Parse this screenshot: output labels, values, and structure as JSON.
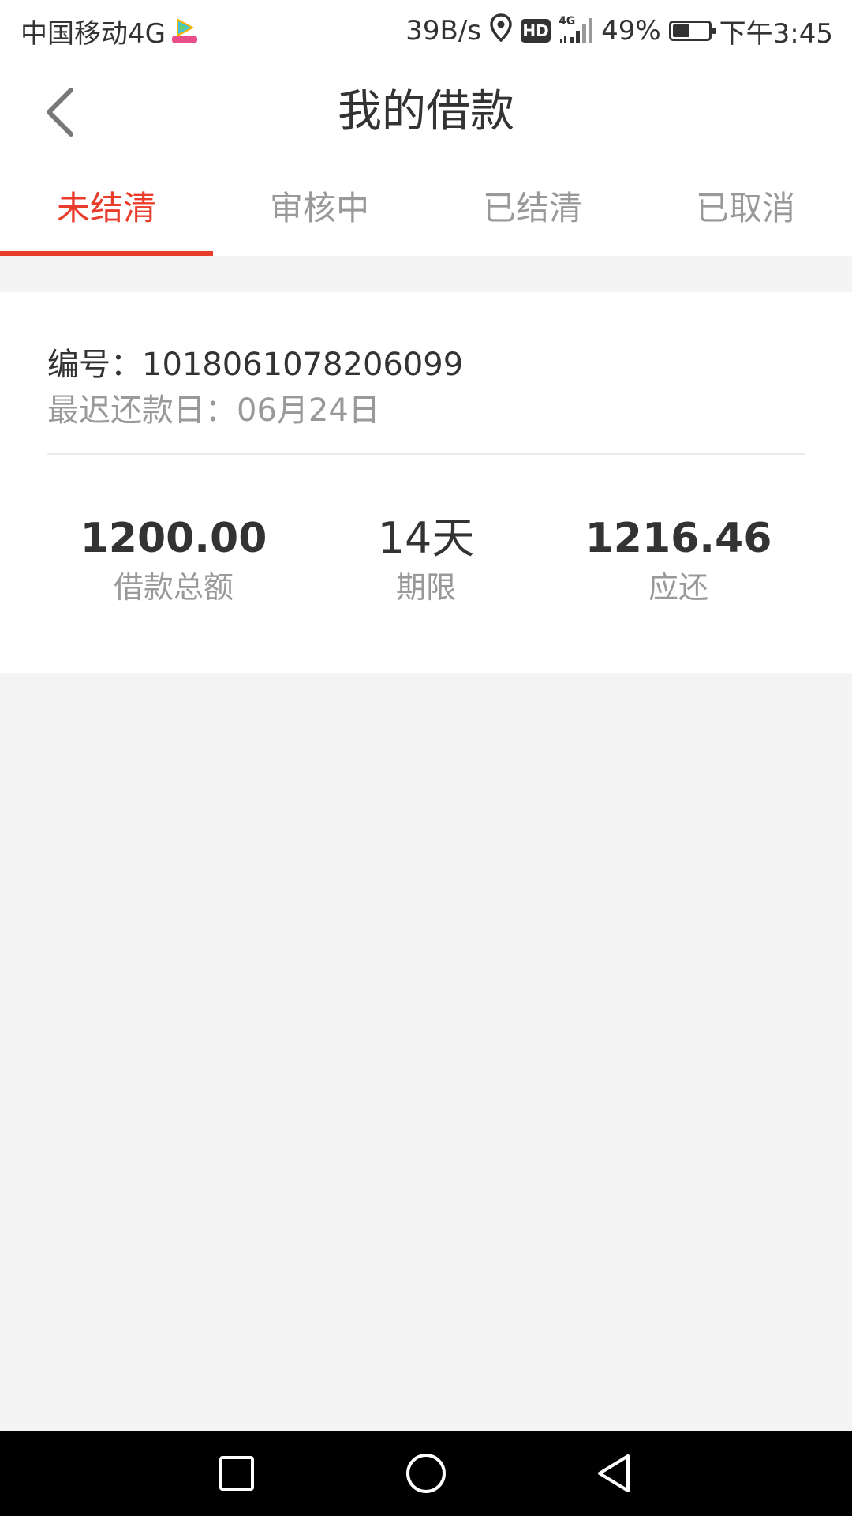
{
  "status_bar": {
    "carrier": "中国移动4G",
    "speed": "39B/s",
    "hd": "HD",
    "network": "4G",
    "battery": "49%",
    "battery_level": 0.49,
    "time": "下午3:45"
  },
  "header": {
    "title": "我的借款"
  },
  "tabs": [
    {
      "label": "未结清",
      "active": true
    },
    {
      "label": "审核中",
      "active": false
    },
    {
      "label": "已结清",
      "active": false
    },
    {
      "label": "已取消",
      "active": false
    }
  ],
  "loan": {
    "number_text": "编号：1018061078206099",
    "due_text": "最迟还款日：06月24日",
    "stats": [
      {
        "value": "1200.00",
        "label": "借款总额"
      },
      {
        "value": "14天",
        "label": "期限"
      },
      {
        "value": "1216.46",
        "label": "应还"
      }
    ]
  },
  "colors": {
    "accent": "#e93c2b",
    "text_primary": "#333333",
    "text_secondary": "#999999",
    "background": "#f4f4f4"
  }
}
